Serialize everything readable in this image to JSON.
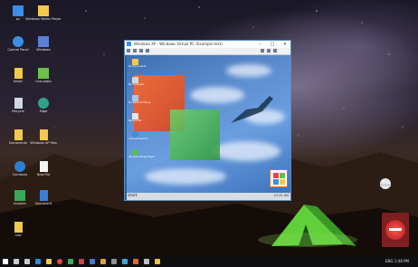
{
  "vm_window": {
    "title": "Windows XP - Windows Virtual PC (Example text)",
    "controls": "– □ ×",
    "guest_taskbar": {
      "start_label": "start",
      "tray_time": "10:15 AM"
    },
    "guest_icons": [
      {
        "label": "My Documents",
        "icon": "folder-icon",
        "color": "#f2c94c"
      },
      {
        "label": "My Computer",
        "icon": "computer-icon",
        "color": "#d0d7e2"
      },
      {
        "label": "My Network Places",
        "icon": "network-icon",
        "color": "#a7c6ef"
      },
      {
        "label": "Recycle Bin",
        "icon": "recycle-bin-icon",
        "color": "#e0e6ee"
      },
      {
        "label": "Internet Explorer",
        "icon": "ie-icon",
        "color": "#3a8ee6"
      },
      {
        "label": "Windows Media Player",
        "icon": "media-icon",
        "color": "#5cbf4a"
      }
    ]
  },
  "host_desktop_icons": [
    {
      "label": "pc",
      "icon": "computer-icon",
      "color": "#3a8ee6"
    },
    {
      "label": "Windows Media Player",
      "icon": "app-icon",
      "color": "#f2c94c"
    },
    {
      "label": "Control Panel",
      "icon": "settings-icon",
      "color": "#3a8ee6"
    },
    {
      "label": "Windows",
      "icon": "window-icon",
      "color": "#5a7fd6"
    },
    {
      "label": "folder",
      "icon": "folder-icon",
      "color": "#f2c94c"
    },
    {
      "label": "Calculator",
      "icon": "app-icon",
      "color": "#6fbf4a"
    },
    {
      "label": "Recycle",
      "icon": "recycle-bin-icon",
      "color": "#d0d7e2"
    },
    {
      "label": "Edge",
      "icon": "browser-icon",
      "color": "#2fa38a"
    },
    {
      "label": "Documents",
      "icon": "folder-icon",
      "color": "#f2c94c"
    },
    {
      "label": "Windows XP files",
      "icon": "folder-icon",
      "color": "#f2c94c"
    },
    {
      "label": "Camtasia",
      "icon": "app-icon",
      "color": "#2d7fd0"
    },
    {
      "label": "New File",
      "icon": "file-icon",
      "color": "#f4f4f4"
    },
    {
      "label": "Installer",
      "icon": "app-icon",
      "color": "#3aa85a"
    },
    {
      "label": "Document",
      "icon": "document-icon",
      "color": "#3a7fd6"
    },
    {
      "label": "new",
      "icon": "folder-icon",
      "color": "#f2c94c"
    }
  ],
  "host_taskbar": {
    "items": [
      {
        "icon": "windows-start-icon",
        "color": "#ffffff"
      },
      {
        "icon": "search-icon",
        "color": "#cccccc"
      },
      {
        "icon": "task-view-icon",
        "color": "#cccccc"
      },
      {
        "icon": "browser-icon",
        "color": "#2f8bd8"
      },
      {
        "icon": "folder-icon",
        "color": "#f2c94c"
      },
      {
        "icon": "chrome-icon",
        "color": "#e8453c"
      },
      {
        "icon": "media-icon",
        "color": "#3fae5a"
      },
      {
        "icon": "app-icon",
        "color": "#d04040"
      },
      {
        "icon": "app-icon",
        "color": "#4a78d0"
      },
      {
        "icon": "app-icon",
        "color": "#e0a040"
      },
      {
        "icon": "app-icon",
        "color": "#909090"
      },
      {
        "icon": "app-icon",
        "color": "#3fa8d0"
      },
      {
        "icon": "app-icon",
        "color": "#e06a2a"
      },
      {
        "icon": "app-icon",
        "color": "#c0c0c0"
      },
      {
        "icon": "app-icon",
        "color": "#f0c040"
      }
    ],
    "tray_text": "ENG  1:48 PM"
  }
}
